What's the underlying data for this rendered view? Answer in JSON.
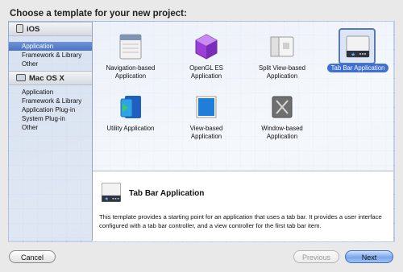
{
  "dialog": {
    "title": "Choose a template for your new project:"
  },
  "sidebar": {
    "groups": [
      {
        "header": "iOS",
        "icon": "ios-device-icon",
        "items": [
          "Application",
          "Framework & Library",
          "Other"
        ],
        "selected_index": 0
      },
      {
        "header": "Mac OS X",
        "icon": "mac-computer-icon",
        "items": [
          "Application",
          "Framework & Library",
          "Application Plug-in",
          "System Plug-in",
          "Other"
        ]
      }
    ]
  },
  "templates": [
    {
      "label_line1": "Navigation-based",
      "label_line2": "Application",
      "icon": "navigation-app-icon"
    },
    {
      "label_line1": "OpenGL ES",
      "label_line2": "Application",
      "icon": "opengl-es-icon"
    },
    {
      "label_line1": "Split View-based",
      "label_line2": "Application",
      "icon": "split-view-icon"
    },
    {
      "label_line1": "Tab Bar Application",
      "label_line2": "",
      "icon": "tab-bar-app-icon",
      "selected": true
    },
    {
      "label_line1": "Utility Application",
      "label_line2": "",
      "icon": "utility-app-icon"
    },
    {
      "label_line1": "View-based",
      "label_line2": "Application",
      "icon": "view-based-icon"
    },
    {
      "label_line1": "Window-based",
      "label_line2": "Application",
      "icon": "window-based-icon"
    }
  ],
  "description": {
    "title": "Tab Bar Application",
    "text": "This template provides a starting point for an application that uses a tab bar. It provides a user interface configured with a tab bar controller, and a view controller for the first tab bar item."
  },
  "buttons": {
    "cancel": "Cancel",
    "previous": "Previous",
    "next": "Next"
  },
  "colors": {
    "selection": "#4a72c1",
    "default_button": "#7aa7ea"
  }
}
